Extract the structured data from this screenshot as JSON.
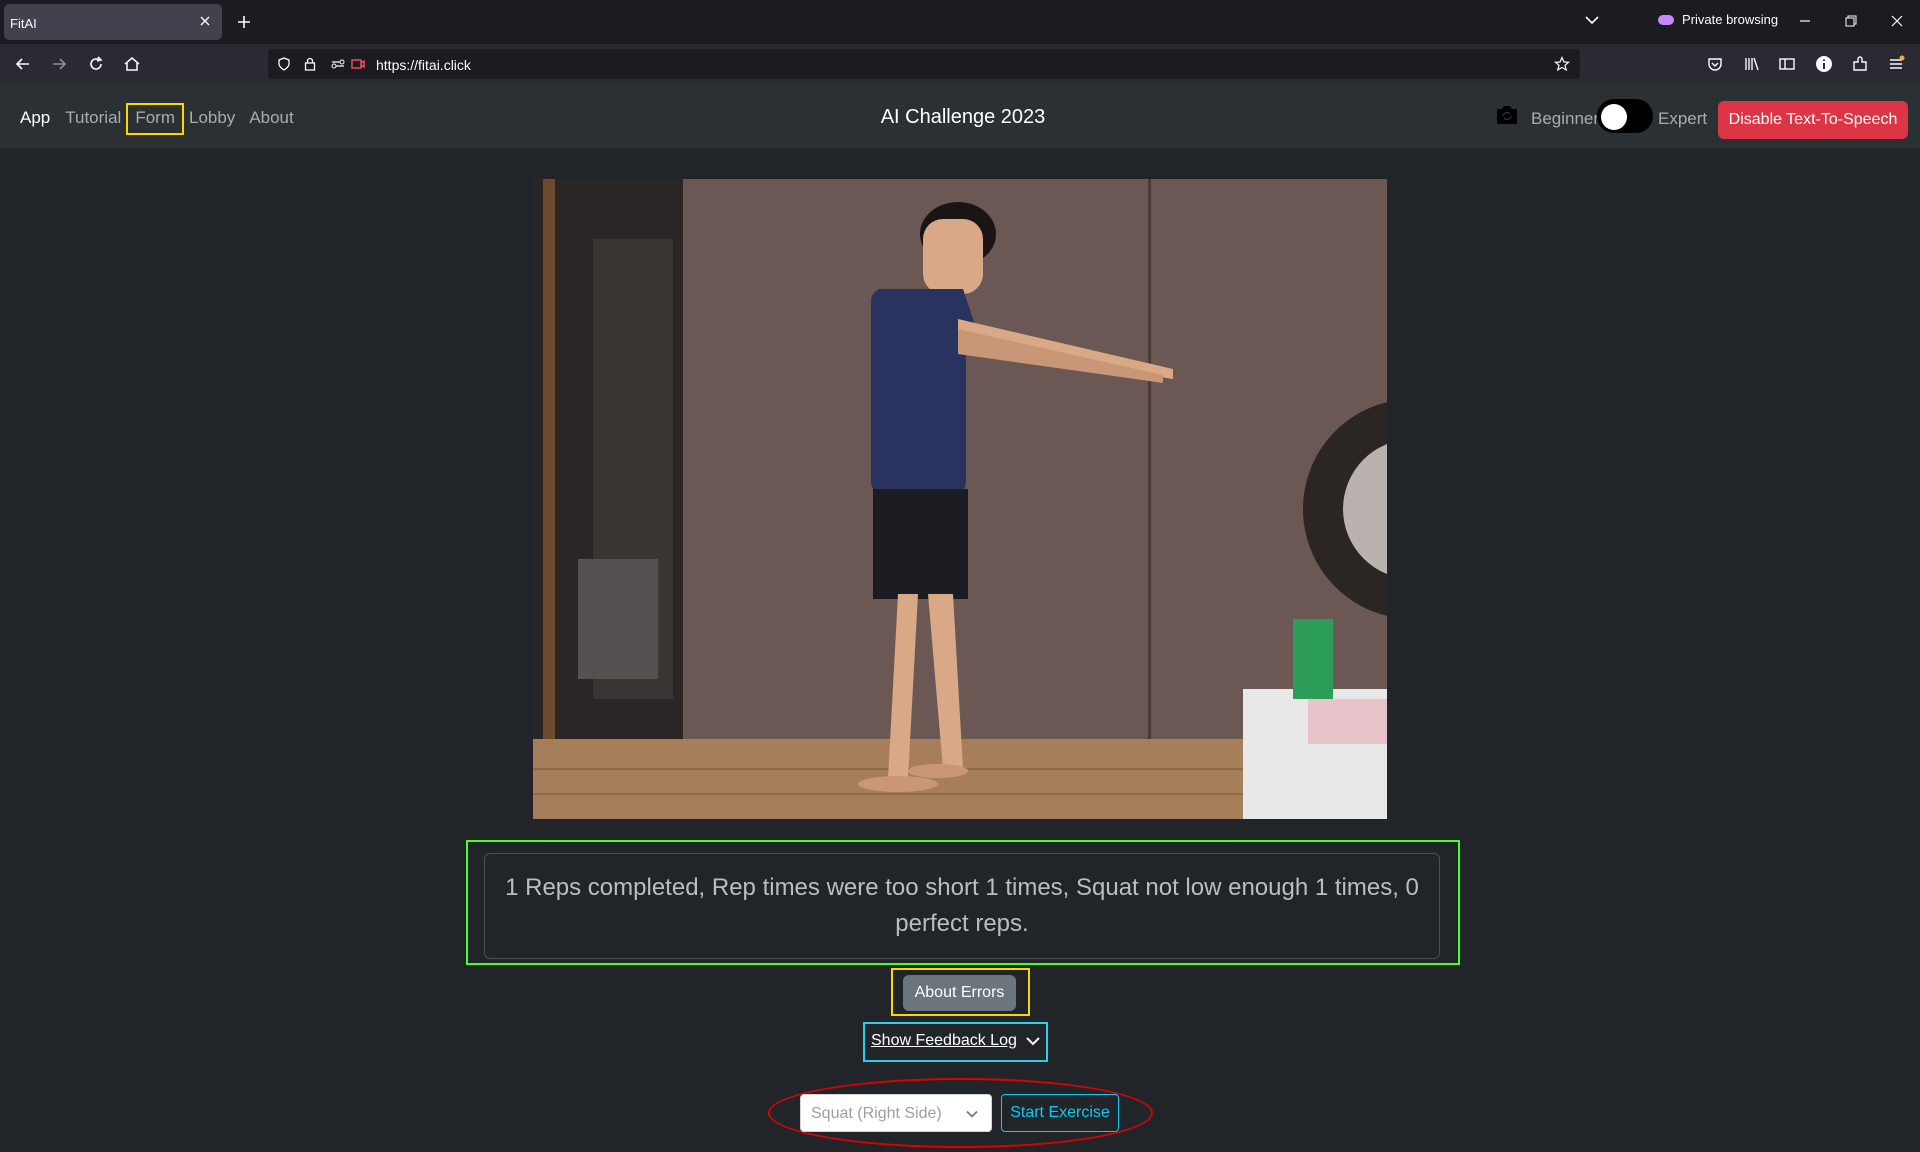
{
  "browser": {
    "tab_title": "FitAI",
    "url": "https://fitai.click",
    "private_label": "Private browsing"
  },
  "nav": {
    "brand": "App",
    "links": [
      "Tutorial",
      "Form",
      "Lobby",
      "About"
    ]
  },
  "header": {
    "title": "AI Challenge 2023",
    "level_left": "Beginner",
    "level_right": "Expert",
    "tts_button": "Disable Text-To-Speech"
  },
  "feedback": {
    "text": "1 Reps completed, Rep times were too short 1 times, Squat not low enough 1 times, 0 perfect reps."
  },
  "buttons": {
    "about_errors": "About Errors",
    "feedback_log": "Show Feedback Log",
    "start": "Start Exercise"
  },
  "exercise_select": {
    "value": "Squat (Right Side)"
  },
  "colors": {
    "accent_red": "#dc3545",
    "info": "#0dcaf0",
    "highlight_green": "#4cff1f",
    "highlight_yellow": "#ffd600",
    "highlight_cyan": "#29d0e6",
    "annotation_red": "#e00000"
  }
}
